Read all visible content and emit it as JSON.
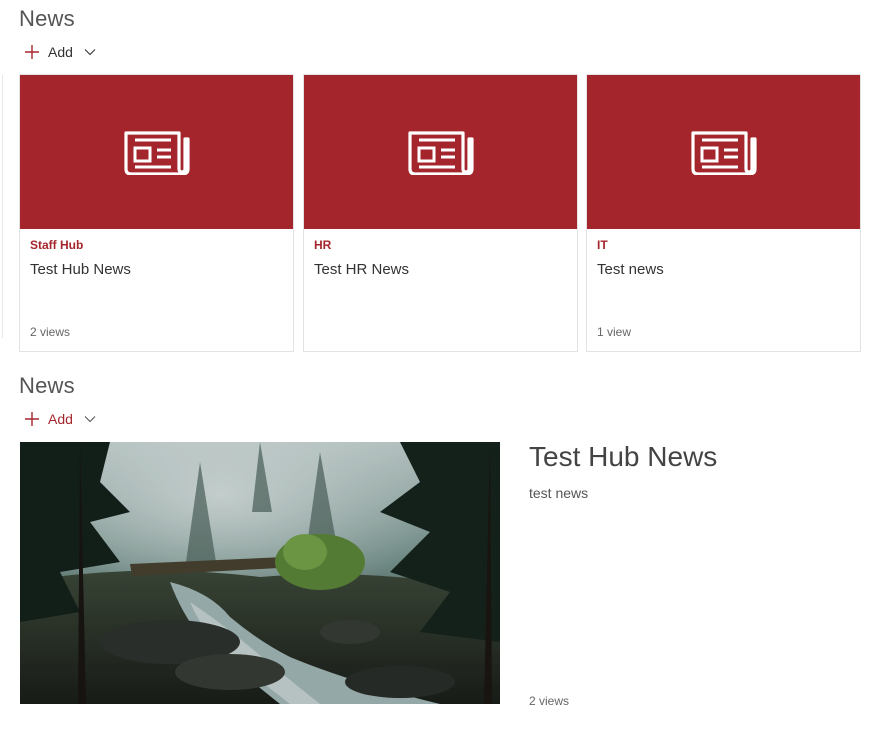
{
  "sections": [
    {
      "title": "News",
      "add_label": "Add",
      "cards": [
        {
          "site": "Staff Hub",
          "title": "Test Hub News",
          "views": "2 views"
        },
        {
          "site": "HR",
          "title": "Test HR News",
          "views": ""
        },
        {
          "site": "IT",
          "title": "Test news",
          "views": "1 view"
        }
      ]
    },
    {
      "title": "News",
      "add_label": "Add",
      "hero": {
        "title": "Test Hub News",
        "description": "test news",
        "views": "2 views"
      }
    }
  ],
  "colors": {
    "accent": "#a4262c",
    "section_title": "#555555",
    "card_border": "#e3e3e3"
  },
  "icons": {
    "add": "plus-icon",
    "dropdown": "chevron-down-icon",
    "card_thumbnail": "newspaper-icon"
  }
}
